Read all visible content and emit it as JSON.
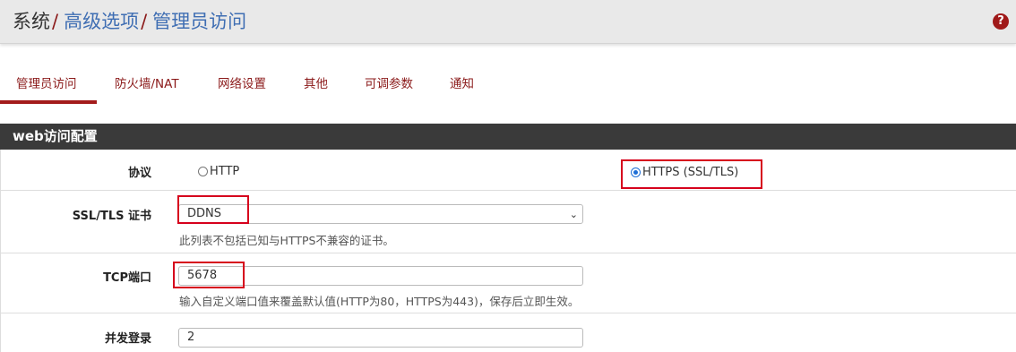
{
  "breadcrumb": {
    "root": "系统",
    "sep1": "/",
    "level2": "高级选项",
    "sep2": "/",
    "level3": "管理员访问"
  },
  "help_icon": "?",
  "tabs": [
    {
      "label": "管理员访问",
      "active": true
    },
    {
      "label": "防火墙/NAT"
    },
    {
      "label": "网络设置"
    },
    {
      "label": "其他"
    },
    {
      "label": "可调参数"
    },
    {
      "label": "通知"
    }
  ],
  "panel": {
    "title": "web访问配置"
  },
  "protocol": {
    "label": "协议",
    "options": [
      "HTTP",
      "HTTPS (SSL/TLS)"
    ],
    "selected": "HTTPS (SSL/TLS)"
  },
  "ssl_cert": {
    "label": "SSL/TLS 证书",
    "value": "DDNS",
    "hint": "此列表不包括已知与HTTPS不兼容的证书。"
  },
  "tcp_port": {
    "label": "TCP端口",
    "value": "5678",
    "hint": "输入自定义端口值来覆盖默认值(HTTP为80，HTTPS为443)，保存后立即生效。"
  },
  "concurrent_login": {
    "label": "并发登录",
    "value": "2"
  },
  "colors": {
    "accent": "#8b1a1a",
    "link": "#3f6eb3",
    "highlight": "#d6001c"
  }
}
